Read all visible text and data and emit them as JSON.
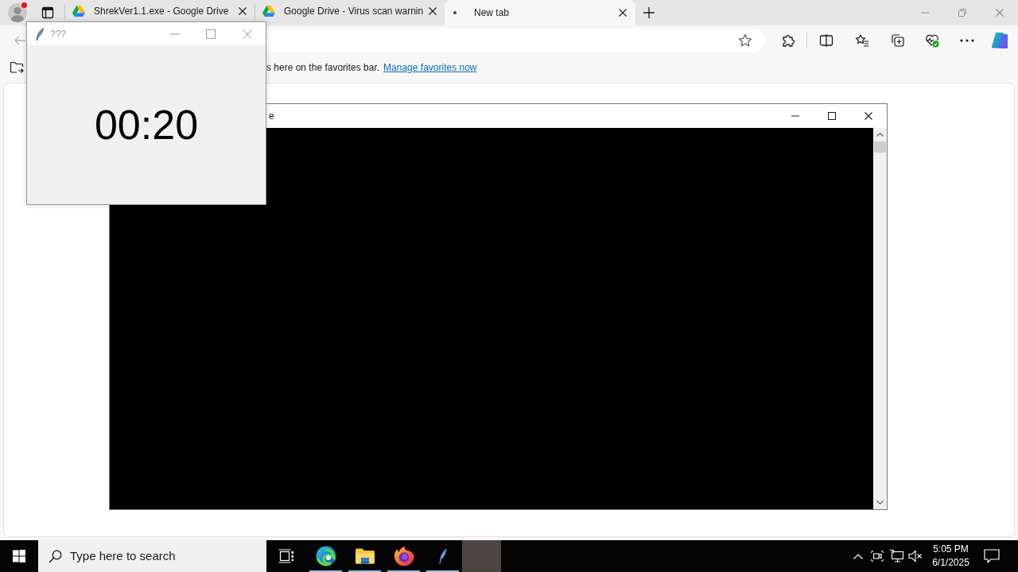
{
  "browser": {
    "tabs": [
      {
        "title": "ShrekVer1.1.exe - Google Drive",
        "kind": "drive",
        "selected": false
      },
      {
        "title": "Google Drive - Virus scan warnin",
        "kind": "drive",
        "selected": false
      },
      {
        "title": "New tab",
        "kind": "loading",
        "selected": true
      }
    ],
    "favorites_bar": {
      "message": "s here on the favorites bar.",
      "link": "Manage favorites now"
    }
  },
  "console_window": {
    "title": "e"
  },
  "timer_window": {
    "title": "???",
    "countdown": "00:20"
  },
  "taskbar": {
    "search": {
      "placeholder": "Type here to search"
    },
    "apps": [
      {
        "kind": "task_view",
        "running": false,
        "selected": false
      },
      {
        "kind": "edge",
        "running": true,
        "selected": false
      },
      {
        "kind": "explorer",
        "running": true,
        "selected": false
      },
      {
        "kind": "firefox",
        "running": true,
        "selected": false
      },
      {
        "kind": "feather",
        "running": true,
        "selected": false
      },
      {
        "kind": "blank",
        "running": false,
        "selected": true
      }
    ],
    "clock": {
      "time": "5:05 PM",
      "date": "6/1/2025"
    }
  }
}
